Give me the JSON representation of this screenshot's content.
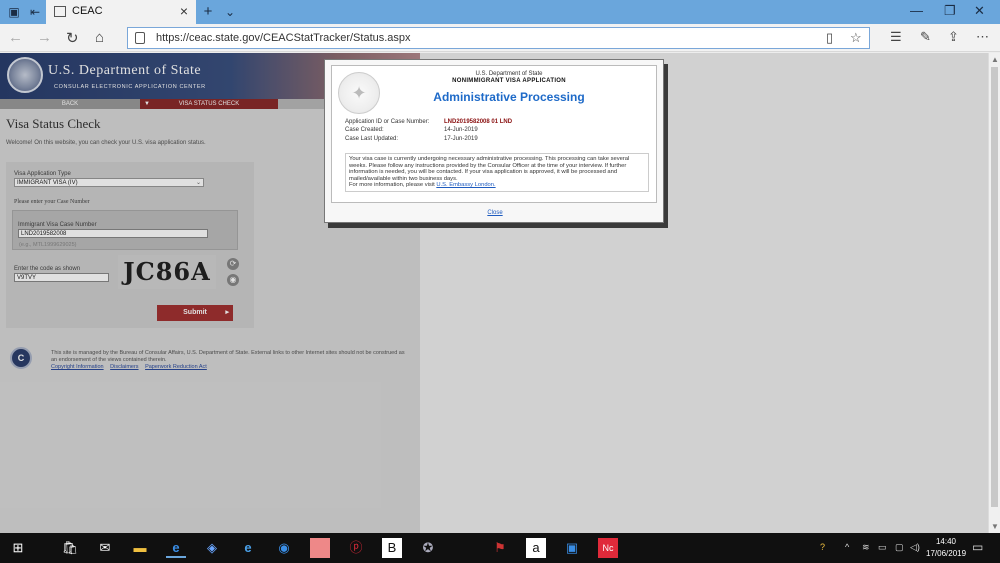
{
  "browser": {
    "tab_title": "CEAC",
    "url": "https://ceac.state.gov/CEACStatTracker/Status.aspx",
    "icons": [
      "tab-preview-icon",
      "set-aside-tabs-icon",
      "close-icon",
      "new-tab-icon",
      "chevron-down-icon",
      "minimize-icon",
      "restore-icon",
      "window-close-icon",
      "back-icon",
      "forward-icon",
      "refresh-icon",
      "home-icon",
      "lock-icon",
      "reading-view-icon",
      "favorite-star-icon",
      "favorites-hub-icon",
      "pen-icon",
      "share-icon",
      "more-icon"
    ]
  },
  "site": {
    "agency": "U.S. Department of State",
    "subtitle": "CONSULAR ELECTRONIC APPLICATION CENTER",
    "nav_back": "BACK",
    "nav_status": "VISA STATUS CHECK",
    "heading": "Visa Status Check",
    "welcome": "Welcome! On this website, you can check your U.S. visa application status.",
    "visa_type_label": "Visa Application Type",
    "visa_type_value": "IMMIGRANT VISA (IV)",
    "case_prompt": "Please enter your Case Number",
    "case_label": "Immigrant Visa Case Number",
    "case_value": "LND2019582008",
    "case_example": "(e.g., MTL1999629025)",
    "code_label": "Enter the code as shown",
    "code_value": "V9TVY",
    "captcha_text": "JC86A",
    "submit_label": "Submit",
    "footer_text": "This site is managed by the Bureau of Consular Affairs, U.S. Department of State. External links to other Internet sites should not be construed as an endorsement of the views contained therein.",
    "footer_links": [
      "Copyright Information",
      "Disclaimers",
      "Paperwork Reduction Act"
    ]
  },
  "modal": {
    "dept": "U.S. Department of State",
    "app_type": "NONIMMIGRANT VISA APPLICATION",
    "title": "Administrative Processing",
    "appid_label": "Application ID or Case Number:",
    "appid_value": "LND2019582008 01 LND",
    "created_label": "Case Created:",
    "created_value": "14-Jun-2019",
    "updated_label": "Case Last Updated:",
    "updated_value": "17-Jun-2019",
    "message": "Your visa case is currently undergoing necessary administrative processing. This processing can take several weeks. Please follow any instructions provided by the Consular Officer at the time of your interview. If further information is needed, you will be contacted. If your visa application is approved, it will be processed and mailed/available within two business days.",
    "more_info": "For more information, please visit",
    "link_text": "U.S. Embassy London.",
    "close_label": "Close"
  },
  "taskbar": {
    "time": "14:40",
    "date": "17/06/2019",
    "apps": [
      "start",
      "store",
      "mail",
      "file-explorer",
      "edge",
      "dropbox",
      "internet-explorer",
      "messenger",
      "photos",
      "pinterest",
      "word",
      "state-dept",
      "flag",
      "amazon",
      "window",
      "netflix"
    ]
  }
}
